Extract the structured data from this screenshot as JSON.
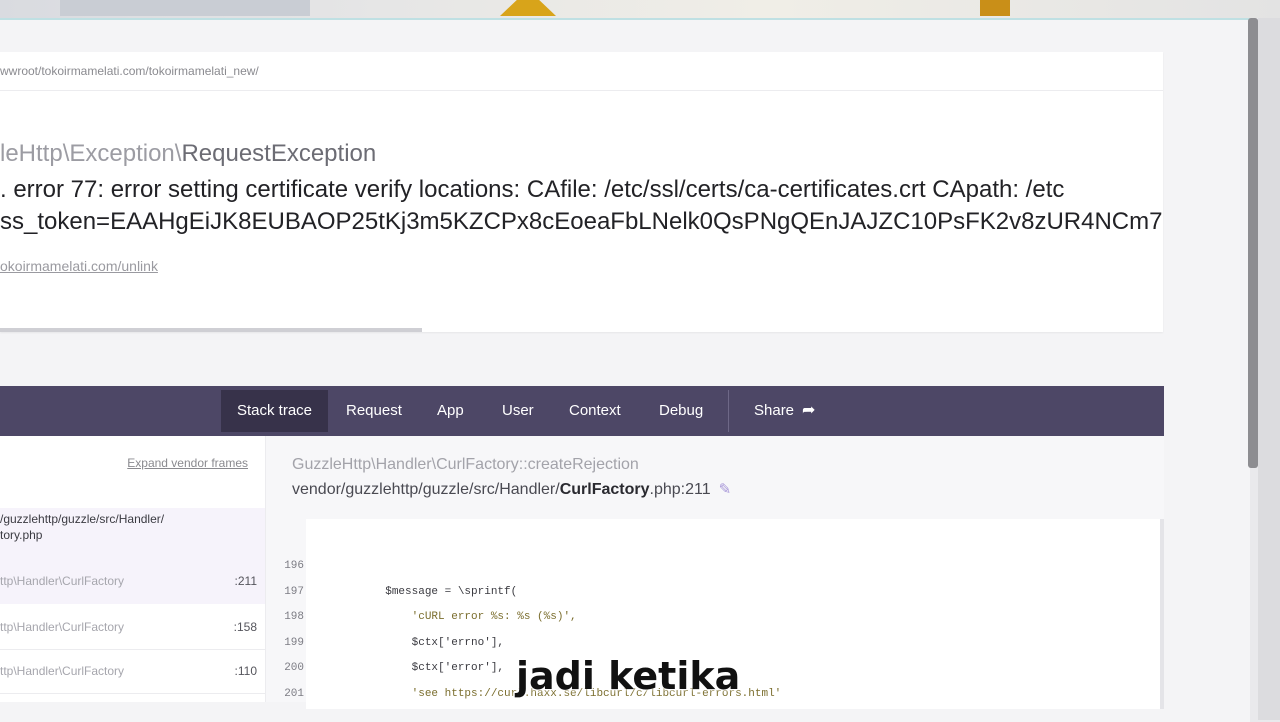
{
  "header_card": {
    "path": "wwroot/tokoirmamelati.com/tokoirmamelati_new/",
    "exception_prefix": "leHttp\\Exception\\",
    "exception_class": "RequestException",
    "message_line1": ". error 77: error setting certificate verify locations: CAfile: /etc/ssl/certs/ca-certificates.crt CApath: /etc",
    "message_line2": "ss_token=EAAHgEiJK8EUBAOP25tKj3m5KZCPx8cEoeaFbLNelk0QsPNgQEnJAJZC10PsFK2v8zUR4NCm7",
    "url": "okoirmamelati.com/unlink"
  },
  "nav": {
    "tabs": [
      {
        "label": "Stack trace"
      },
      {
        "label": "Request"
      },
      {
        "label": "App"
      },
      {
        "label": "User"
      },
      {
        "label": "Context"
      },
      {
        "label": "Debug"
      }
    ],
    "share_label": "Share"
  },
  "frames": {
    "expand_label": "Expand vendor frames",
    "file_path_line1": "/guzzlehttp/guzzle/src/Handler/",
    "file_path_line2": "tory.php",
    "rows": [
      {
        "class": "ttp\\Handler\\CurlFactory",
        "line": ":211"
      },
      {
        "class": "ttp\\Handler\\CurlFactory",
        "line": ":158"
      },
      {
        "class": "ttp\\Handler\\CurlFactory",
        "line": ":110"
      }
    ]
  },
  "code": {
    "function": "GuzzleHttp\\Handler\\CurlFactory::createRejection",
    "file_prefix": "vendor/guzzlehttp/guzzle/src/Handler/",
    "file_name": "CurlFactory",
    "file_suffix": ".php:211",
    "line_numbers": [
      "196",
      "197",
      "198",
      "199",
      "200",
      "201"
    ],
    "lines": [
      "",
      "            $message = \\sprintf(",
      "                'cURL error %s: %s (%s)',",
      "                $ctx['errno'],",
      "                $ctx['error'],",
      "                'see https://curl.haxx.se/libcurl/c/libcurl-errors.html'"
    ]
  },
  "subtitle": "jadi ketika"
}
